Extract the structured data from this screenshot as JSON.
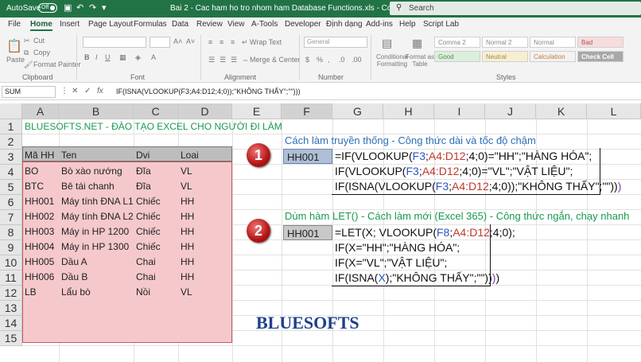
{
  "titlebar": {
    "autosave_label": "AutoSave",
    "autosave_state": "Off",
    "document_title": "Bai 2 - Cac ham ho tro nhom ham Database Functions.xls  -  Compatibility Mode",
    "search_placeholder": "Search"
  },
  "ribbon": {
    "tabs": [
      "File",
      "Home",
      "Insert",
      "Page Layout",
      "Formulas",
      "Data",
      "Review",
      "View",
      "A-Tools",
      "Developer",
      "Định dạng",
      "Add-ins",
      "Help",
      "Script Lab"
    ],
    "active_tab": "Home",
    "clipboard": {
      "paste": "Paste",
      "cut": "Cut",
      "copy": "Copy",
      "format_painter": "Format Painter",
      "group": "Clipboard"
    },
    "font": {
      "group": "Font",
      "bold": "B",
      "italic": "I",
      "underline": "U"
    },
    "alignment": {
      "wrap": "Wrap Text",
      "merge": "Merge & Center",
      "group": "Alignment"
    },
    "number": {
      "format": "General",
      "group": "Number"
    },
    "styles": {
      "conditional": "Conditional Formatting",
      "format_as_table": "Format as Table",
      "boxes": [
        "Comma 2",
        "Normal 2",
        "Normal",
        "Bad",
        "Good",
        "Neutral",
        "Calculation",
        "Check Cell"
      ],
      "group": "Styles"
    }
  },
  "formula_bar": {
    "name_box": "SUM",
    "formula": "IF(ISNA(VLOOKUP(F3;A4:D12;4;0));\"KHÔNG THẤY\";\"\")))"
  },
  "columns": [
    "A",
    "B",
    "C",
    "D",
    "E",
    "F",
    "G",
    "H",
    "I",
    "J",
    "K",
    "L"
  ],
  "rows": [
    "1",
    "2",
    "3",
    "4",
    "5",
    "6",
    "7",
    "8",
    "9",
    "10",
    "11",
    "12",
    "13",
    "14",
    "15"
  ],
  "banner": "BLUESOFTS.NET - ĐÀO TẠO EXCEL CHO NGƯỜI ĐI LÀM",
  "table": {
    "headers": [
      "Mã HH",
      "Ten",
      "Dvi",
      "Loai"
    ],
    "rows": [
      [
        "BO",
        "Bò xào nướng",
        "Đĩa",
        "VL"
      ],
      [
        "BTC",
        "Bê tái chanh",
        "Đĩa",
        "VL"
      ],
      [
        "HH001",
        "Máy tính ĐNA L1",
        "Chiếc",
        "HH"
      ],
      [
        "HH002",
        "Máy tính ĐNA L2",
        "Chiếc",
        "HH"
      ],
      [
        "HH003",
        "Máy in HP 1200",
        "Chiếc",
        "HH"
      ],
      [
        "HH004",
        "Máy in HP 1300",
        "Chiếc",
        "HH"
      ],
      [
        "HH005",
        "Dầu A",
        "Chai",
        "HH"
      ],
      [
        "HH006",
        "Dầu B",
        "Chai",
        "HH"
      ],
      [
        "LB",
        "Lẩu bò",
        "Nồi",
        "VL"
      ]
    ]
  },
  "section1": {
    "number": "1",
    "title": "Cách làm truyền thống - Công thức dài và tốc độ chậm",
    "lookup_value": "HH001"
  },
  "section2": {
    "number": "2",
    "title": "Dùm hàm LET() - Cách làm mới (Excel 365) - Công thức ngắn, chạy nhanh",
    "lookup_value": "HH001"
  },
  "logo": "BLUESOFTS",
  "colors": {
    "accent": "#217346",
    "pink": "#f5c9cc",
    "green_text": "#1a9950",
    "blue_ref": "#2a56c6"
  }
}
